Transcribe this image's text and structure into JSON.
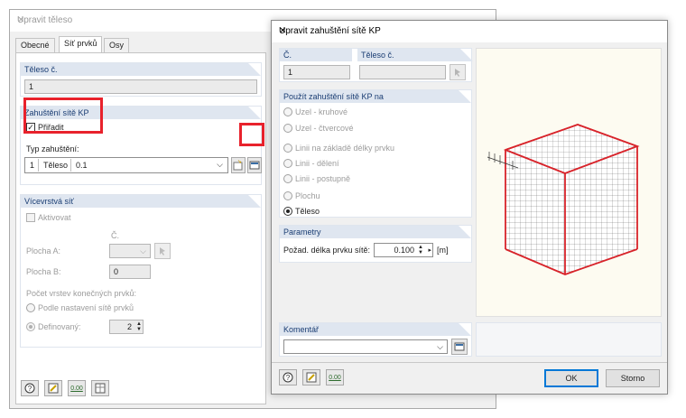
{
  "bg": {
    "title": "Upravit těleso",
    "tabs": [
      "Obecné",
      "Síť prvků",
      "Osy"
    ],
    "teleso_hdr": "Těleso č.",
    "teleso_no": "1",
    "zahust_hdr": "Zahuštění sítě KP",
    "assign_label": "Přiřadit",
    "typ_label": "Typ zahuštění:",
    "typ_no": "1",
    "typ_kind": "Těleso",
    "typ_val": "0.1",
    "multi_hdr": "Vícevrstvá síť",
    "activate": "Aktivovat",
    "col_c": "Č.",
    "plocha_a": "Plocha A:",
    "plocha_b": "Plocha B:",
    "plocha_b_val": "0",
    "layers_label": "Počet vrstev konečných prvků:",
    "opt_settings": "Podle nastavení sítě prvků",
    "opt_defined": "Definovaný:",
    "defined_val": "2"
  },
  "fg": {
    "title": "Upravit zahuštění sítě KP",
    "col_c": "Č.",
    "col_teleso": "Těleso č.",
    "c_val": "1",
    "use_hdr": "Použít zahuštění sítě KP na",
    "options": [
      "Uzel - kruhové",
      "Uzel - čtvercové",
      "Linii na základě délky prvku",
      "Linii - dělení",
      "Linii - postupně",
      "Plochu",
      "Těleso"
    ],
    "param_hdr": "Parametry",
    "param_label": "Požad. délka prvku sítě:",
    "param_val": "0.100",
    "param_unit": "[m]",
    "comment_hdr": "Komentář",
    "ok": "OK",
    "cancel": "Storno",
    "zero_label": "0.00"
  },
  "colors": {
    "highlight": "#e8222c",
    "section_header": "#dfe6f0",
    "cube_edge": "#d8232a"
  }
}
